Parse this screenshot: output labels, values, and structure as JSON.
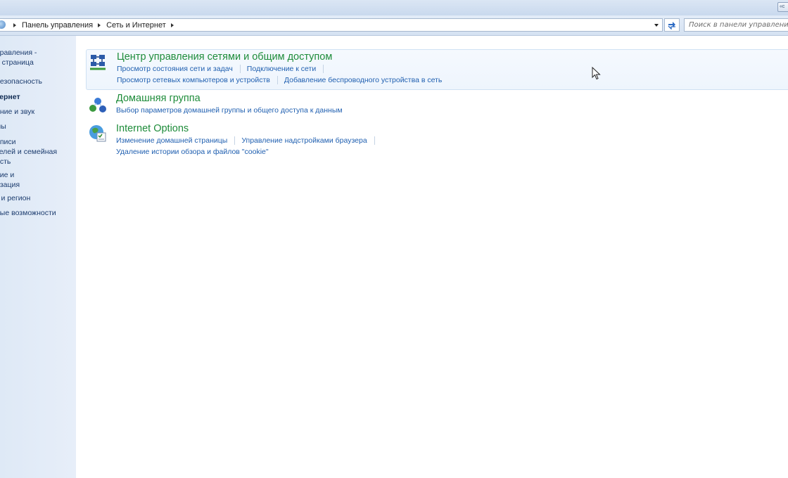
{
  "window": {
    "corner_button_text": "«c"
  },
  "address_bar": {
    "breadcrumbs": [
      "Панель управления",
      "Сеть и Интернет"
    ],
    "refresh_icon": "refresh-icon"
  },
  "search": {
    "placeholder": "Поиск в панели управления"
  },
  "sidebar": {
    "items": [
      {
        "label": "правления -\nя страница",
        "active": false
      },
      {
        "label": "безопасность",
        "active": false
      },
      {
        "label": "тернет",
        "active": true
      },
      {
        "label": "ание и звук",
        "active": false
      },
      {
        "label": "мы",
        "active": false
      },
      {
        "label": "аписи\nтелей и семейная\nость",
        "active": false
      },
      {
        "label": "ние и\nизация",
        "active": false
      },
      {
        "label": "к и регион",
        "active": false
      },
      {
        "label": "ные возможности",
        "active": false
      }
    ]
  },
  "categories": [
    {
      "title": "Центр управления сетями и общим доступом",
      "icon": "network-center-icon",
      "link_rows": [
        [
          "Просмотр состояния сети и задач",
          "Подключение к сети"
        ],
        [
          "Просмотр сетевых компьютеров и устройств",
          "Добавление беспроводного устройства в сеть"
        ]
      ]
    },
    {
      "title": "Домашняя группа",
      "icon": "homegroup-icon",
      "link_rows": [
        [
          "Выбор параметров домашней группы и общего доступа к данным"
        ]
      ]
    },
    {
      "title": "Internet Options",
      "icon": "internet-options-icon",
      "link_rows": [
        [
          "Изменение домашней страницы",
          "Управление надстройками браузера"
        ],
        [
          "Удаление истории обзора и файлов \"cookie\""
        ]
      ]
    }
  ],
  "colors": {
    "category_title": "#1e8c3a",
    "link": "#1f5fb0",
    "sidebar_bg": "#dee9f6"
  }
}
